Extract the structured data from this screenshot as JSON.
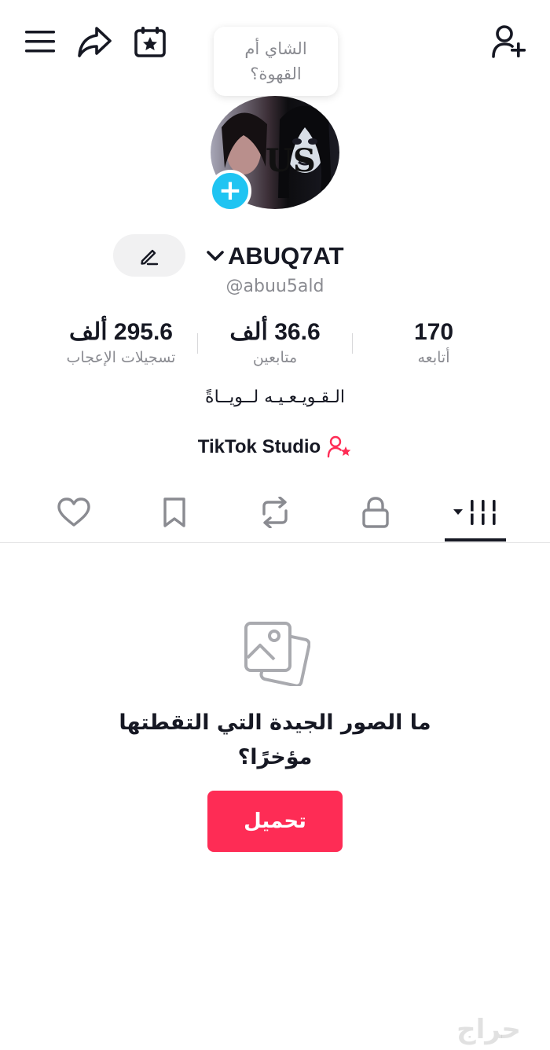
{
  "header": {
    "menu_icon": "hamburger-icon",
    "share_icon": "share-arrow-icon",
    "calendar_icon": "calendar-star-icon",
    "add_friend_icon": "person-add-icon"
  },
  "bubble": {
    "line1": "الشاي أم",
    "line2": "القهوة؟"
  },
  "profile": {
    "username": "ABUQ7AT",
    "handle": "@abuu5ald",
    "bio": "الـقـويـعـيـه لــويــاةً",
    "studio_label": "TikTok Studio"
  },
  "stats": [
    {
      "value": "170",
      "label": "أتابعه"
    },
    {
      "value": "36.6 ألف",
      "label": "متابعين"
    },
    {
      "value": "295.6 ألف",
      "label": "تسجيلات الإعجاب"
    }
  ],
  "tabs": [
    {
      "icon": "grid-icon",
      "selected": true
    },
    {
      "icon": "lock-icon",
      "selected": false
    },
    {
      "icon": "repost-icon",
      "selected": false
    },
    {
      "icon": "bookmark-icon",
      "selected": false
    },
    {
      "icon": "heart-icon",
      "selected": false
    }
  ],
  "empty_state": {
    "icon": "photos-icon",
    "title_line1": "ما الصور الجيدة التي التقطتها",
    "title_line2": "مؤخرًا؟",
    "button": "تحميل"
  },
  "watermark": "حراج",
  "colors": {
    "accent": "#fe2c55",
    "badge": "#20c4f2",
    "muted": "#8a8b91"
  }
}
